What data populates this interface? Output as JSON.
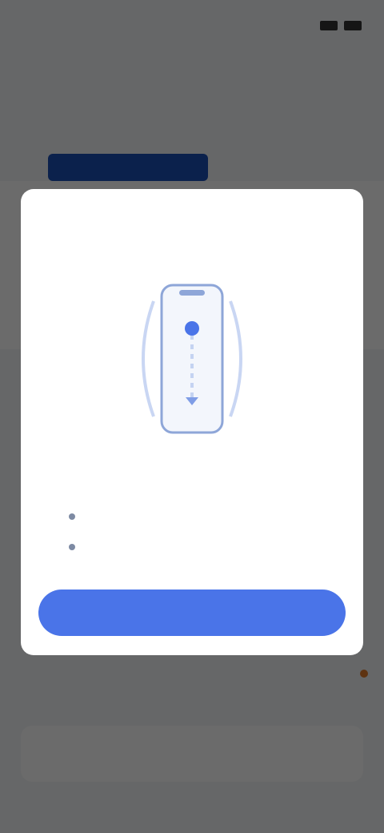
{
  "status_bar": {
    "time": ""
  },
  "app": {
    "title": "",
    "section_heading": "",
    "row_label": ""
  },
  "dialog": {
    "title": "",
    "illustration_icon": "phone-swipe-icon",
    "subtitle": "",
    "tips": [
      "",
      ""
    ],
    "confirm_label": ""
  },
  "colors": {
    "accent": "#4a74e8",
    "scrim": "rgba(0,0,0,0.58)",
    "banner": "#1b4fb5"
  }
}
